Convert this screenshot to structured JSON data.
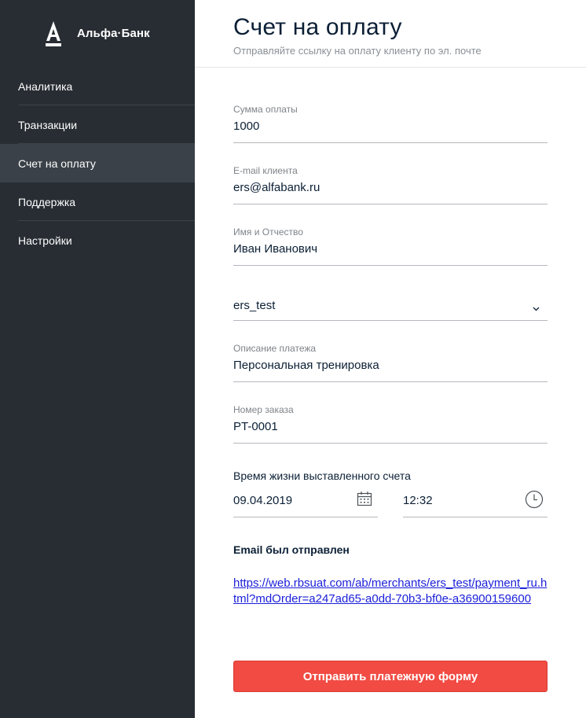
{
  "brand": {
    "name": "Альфа·Банк",
    "logo_icon": "alfa-a-logo-icon"
  },
  "sidebar": {
    "items": [
      {
        "label": "Аналитика",
        "active": false
      },
      {
        "label": "Транзакции",
        "active": false
      },
      {
        "label": "Счет на оплату",
        "active": true
      },
      {
        "label": "Поддержка",
        "active": false
      },
      {
        "label": "Настройки",
        "active": false
      }
    ]
  },
  "header": {
    "title": "Счет на оплату",
    "subtitle": "Отправляйте ссылку на оплату клиенту по эл. почте"
  },
  "form": {
    "amount": {
      "label": "Сумма оплаты",
      "value": "1000"
    },
    "email": {
      "label": "E-mail клиента",
      "value": "ers@alfabank.ru"
    },
    "name": {
      "label": "Имя и Отчество",
      "value": "Иван Иванович"
    },
    "merchant": {
      "value": "ers_test",
      "icon": "chevron-down-icon"
    },
    "description": {
      "label": "Описание платежа",
      "value": "Персональная тренировка"
    },
    "order": {
      "label": "Номер заказа",
      "value": "PT-0001"
    },
    "lifetime": {
      "label": "Время жизни выставленного счета",
      "date": "09.04.2019",
      "time": "12:32",
      "date_icon": "calendar-icon",
      "time_icon": "clock-icon"
    }
  },
  "result": {
    "status": "Email был отправлен",
    "link": "https://web.rbsuat.com/ab/merchants/ers_test/payment_ru.html?mdOrder=a247ad65-a0dd-70b3-bf0e-a36900159600"
  },
  "actions": {
    "submit_label": "Отправить платежную форму"
  },
  "colors": {
    "sidebar_bg": "#272d33",
    "sidebar_active": "#3a4148",
    "accent": "#f14b43",
    "link": "#1a1fd8"
  }
}
